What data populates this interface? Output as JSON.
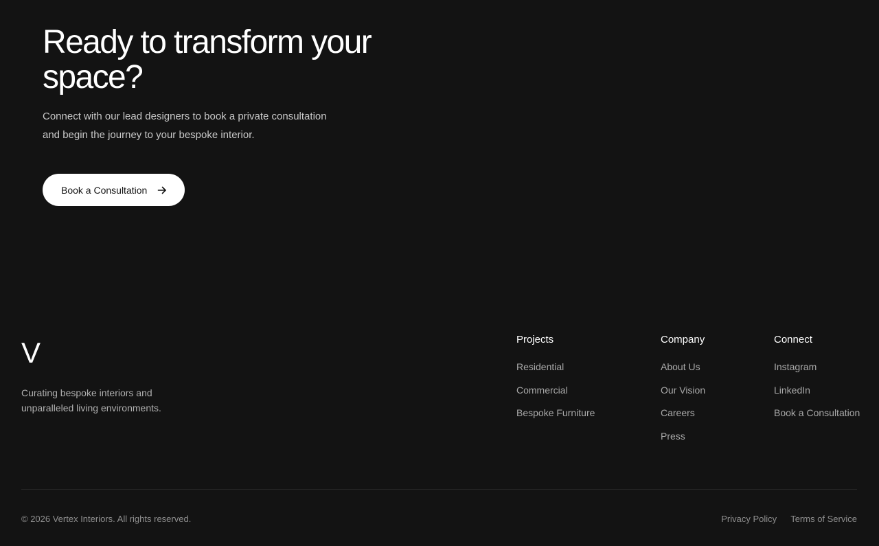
{
  "cta": {
    "heading": "Ready to transform your space?",
    "subtext": "Connect with our lead designers to book a private consultation and begin the journey to your bespoke interior.",
    "button_label": "Book a Consultation",
    "button_icon": "arrow-right-icon"
  },
  "footer": {
    "logo": "V",
    "tagline": "Curating bespoke interiors and unparalleled living environments.",
    "columns": [
      {
        "heading": "Projects",
        "links": [
          "Residential",
          "Commercial",
          "Bespoke Furniture"
        ]
      },
      {
        "heading": "Company",
        "links": [
          "About Us",
          "Our Vision",
          "Careers",
          "Press"
        ]
      },
      {
        "heading": "Connect",
        "links": [
          "Instagram",
          "LinkedIn",
          "Book a Consultation"
        ]
      }
    ],
    "copyright": "© 2026 Vertex Interiors. All rights reserved.",
    "legal_links": [
      "Privacy Policy",
      "Terms of Service"
    ]
  },
  "colors": {
    "background": "#131313",
    "button_bg": "#ffffff",
    "heading_text": "#ffffff",
    "muted_text": "#a9a9a9"
  }
}
